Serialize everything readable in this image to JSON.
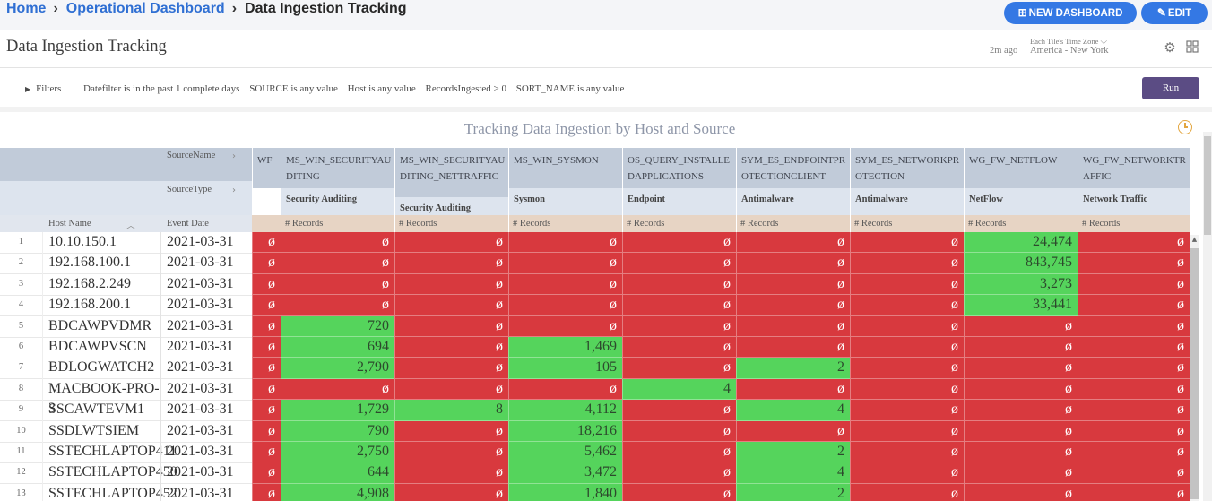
{
  "breadcrumb": {
    "home": "Home",
    "dashboard": "Operational Dashboard",
    "current": "Data Ingestion Tracking",
    "sep": "›"
  },
  "buttons": {
    "new_dashboard": "NEW DASHBOARD",
    "edit": "EDIT"
  },
  "header": {
    "title": "Data Ingestion Tracking",
    "updated": "2m ago",
    "tz_label": "Each Tile's Time Zone",
    "tz_value": "America - New York"
  },
  "filters": {
    "label": "Filters",
    "items": [
      "Datefilter is in the past 1 complete days",
      "SOURCE is any value",
      "Host is any value",
      "RecordsIngested > 0",
      "SORT_NAME is any value"
    ],
    "run": "Run"
  },
  "tile": {
    "title": "Tracking Data Ingestion by Host and Source",
    "source_name_label": "SourceName",
    "source_type_label": "SourceType",
    "host_col": "Host Name",
    "date_col": "Event Date",
    "records_label": "# Records",
    "null_glyph": "ø",
    "columns": [
      {
        "name": "WF",
        "type": ""
      },
      {
        "name": "MS_WIN_SECURITYAUDITING",
        "type": "Security Auditing"
      },
      {
        "name": "MS_WIN_SECURITYAUDITING_NETTRAFFIC",
        "type": "Security Auditing"
      },
      {
        "name": "MS_WIN_SYSMON",
        "type": "Sysmon"
      },
      {
        "name": "OS_QUERY_INSTALLEDAPPLICATIONS",
        "type": "Endpoint"
      },
      {
        "name": "SYM_ES_ENDPOINTPROTECTIONCLIENT",
        "type": "Antimalware"
      },
      {
        "name": "SYM_ES_NETWORKPROTECTION",
        "type": "Antimalware"
      },
      {
        "name": "WG_FW_NETFLOW",
        "type": "NetFlow"
      },
      {
        "name": "WG_FW_NETWORKTRAFFIC",
        "type": "Network Traffic"
      }
    ],
    "rows": [
      {
        "n": "1",
        "host": "10.10.150.1",
        "date": "2021-03-31",
        "vals": [
          null,
          null,
          null,
          null,
          null,
          null,
          null,
          "24,474",
          null
        ]
      },
      {
        "n": "2",
        "host": "192.168.100.1",
        "date": "2021-03-31",
        "vals": [
          null,
          null,
          null,
          null,
          null,
          null,
          null,
          "843,745",
          null
        ]
      },
      {
        "n": "3",
        "host": "192.168.2.249",
        "date": "2021-03-31",
        "vals": [
          null,
          null,
          null,
          null,
          null,
          null,
          null,
          "3,273",
          null
        ]
      },
      {
        "n": "4",
        "host": "192.168.200.1",
        "date": "2021-03-31",
        "vals": [
          null,
          null,
          null,
          null,
          null,
          null,
          null,
          "33,441",
          null
        ]
      },
      {
        "n": "5",
        "host": "BDCAWPVDMR",
        "date": "2021-03-31",
        "vals": [
          null,
          "720",
          null,
          null,
          null,
          null,
          null,
          null,
          null
        ]
      },
      {
        "n": "6",
        "host": "BDCAWPVSCN",
        "date": "2021-03-31",
        "vals": [
          null,
          "694",
          null,
          "1,469",
          null,
          null,
          null,
          null,
          null
        ]
      },
      {
        "n": "7",
        "host": "BDLOGWATCH2",
        "date": "2021-03-31",
        "vals": [
          null,
          "2,790",
          null,
          "105",
          null,
          "2",
          null,
          null,
          null
        ]
      },
      {
        "n": "8",
        "host": "MACBOOK-PRO-3",
        "date": "2021-03-31",
        "vals": [
          null,
          null,
          null,
          null,
          "4",
          null,
          null,
          null,
          null
        ]
      },
      {
        "n": "9",
        "host": "SSCAWTEVM1",
        "date": "2021-03-31",
        "vals": [
          null,
          "1,729",
          "8",
          "4,112",
          null,
          "4",
          null,
          null,
          null
        ]
      },
      {
        "n": "10",
        "host": "SSDLWTSIEM",
        "date": "2021-03-31",
        "vals": [
          null,
          "790",
          null,
          "18,216",
          null,
          null,
          null,
          null,
          null
        ]
      },
      {
        "n": "11",
        "host": "SSTECHLAPTOP411",
        "date": "2021-03-31",
        "vals": [
          null,
          "2,750",
          null,
          "5,462",
          null,
          "2",
          null,
          null,
          null
        ]
      },
      {
        "n": "12",
        "host": "SSTECHLAPTOP450",
        "date": "2021-03-31",
        "vals": [
          null,
          "644",
          null,
          "3,472",
          null,
          "4",
          null,
          null,
          null
        ]
      },
      {
        "n": "13",
        "host": "SSTECHLAPTOP452",
        "date": "2021-03-31",
        "vals": [
          null,
          "4,908",
          null,
          "1,840",
          null,
          "2",
          null,
          null,
          null
        ]
      }
    ]
  },
  "colors": {
    "bad": "#d8393e",
    "good": "#55d45c",
    "accent": "#3478e4",
    "run": "#5b4c84"
  }
}
